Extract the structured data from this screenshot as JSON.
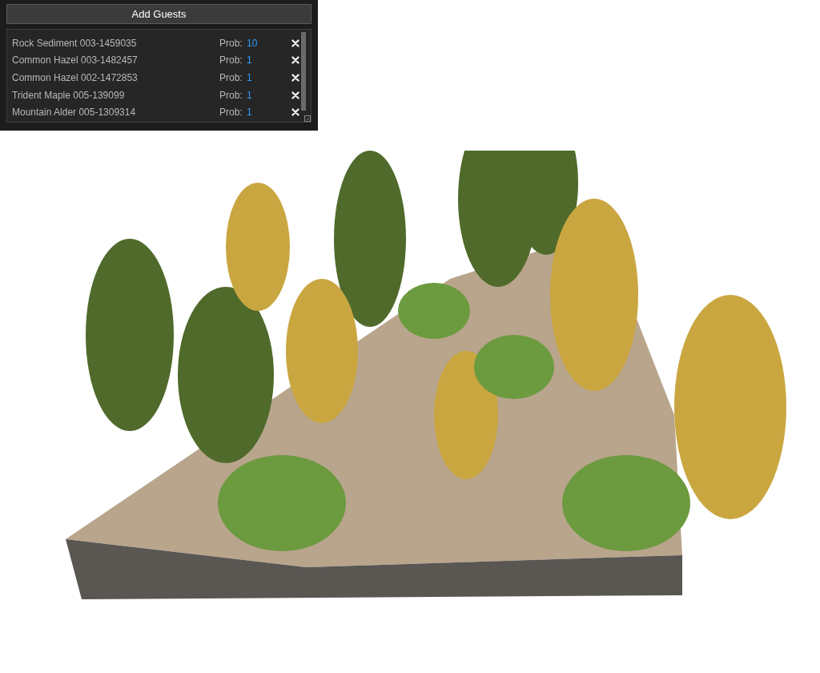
{
  "panel": {
    "button": "Add Guests",
    "guests": [
      {
        "name": "Rock Sediment 003-1459035",
        "prob_label": "Prob:",
        "prob": "10"
      },
      {
        "name": "Common Hazel 003-1482457",
        "prob_label": "Prob:",
        "prob": "1"
      },
      {
        "name": "Common Hazel 002-1472853",
        "prob_label": "Prob:",
        "prob": "1"
      },
      {
        "name": "Trident Maple 005-139099",
        "prob_label": "Prob:",
        "prob": "1"
      },
      {
        "name": "Mountain Alder 005-1309314",
        "prob_label": "Prob:",
        "prob": "1"
      }
    ]
  }
}
